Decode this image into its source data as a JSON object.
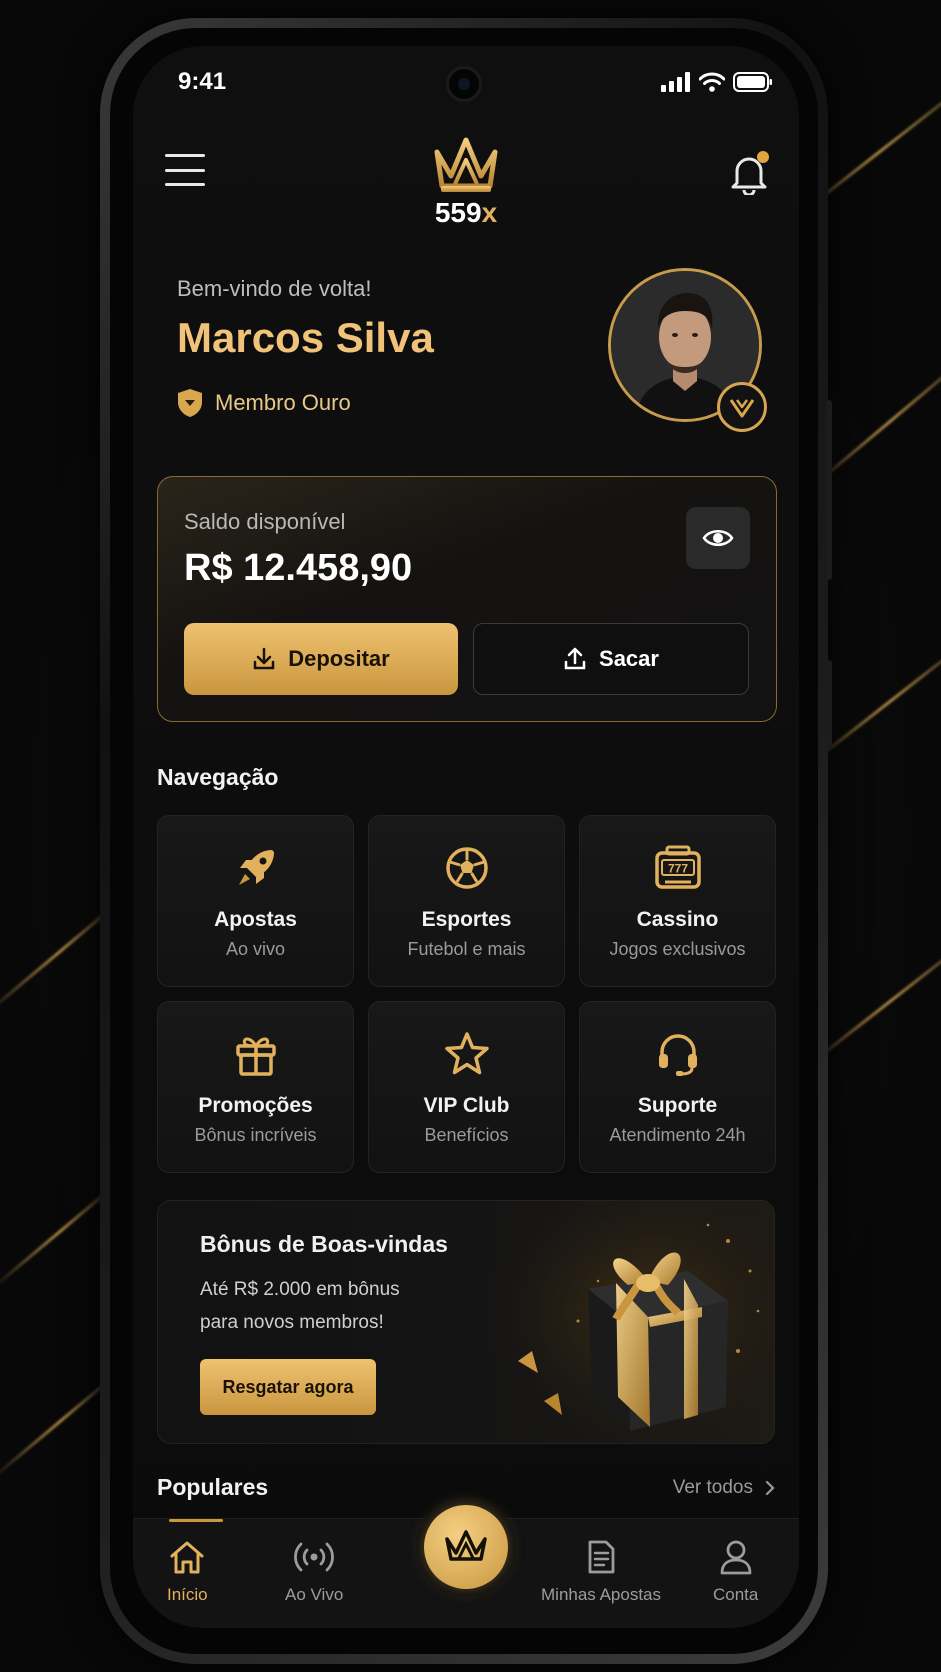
{
  "status_bar": {
    "time": "9:41"
  },
  "header": {
    "logo_text": "559",
    "logo_suffix": "x"
  },
  "profile": {
    "greeting": "Bem-vindo de volta!",
    "name": "Marcos Silva",
    "membership": "Membro Ouro"
  },
  "balance": {
    "label": "Saldo disponível",
    "value": "R$ 12.458,90",
    "deposit_label": "Depositar",
    "withdraw_label": "Sacar"
  },
  "navigation": {
    "title": "Navegação",
    "items": [
      {
        "title": "Apostas",
        "subtitle": "Ao vivo",
        "icon": "rocket-icon"
      },
      {
        "title": "Esportes",
        "subtitle": "Futebol e mais",
        "icon": "soccer-ball-icon"
      },
      {
        "title": "Cassino",
        "subtitle": "Jogos exclusivos",
        "icon": "slot-machine-icon"
      },
      {
        "title": "Promoções",
        "subtitle": "Bônus incríveis",
        "icon": "gift-icon"
      },
      {
        "title": "VIP Club",
        "subtitle": "Benefícios",
        "icon": "star-icon"
      },
      {
        "title": "Suporte",
        "subtitle": "Atendimento 24h",
        "icon": "headset-icon"
      }
    ]
  },
  "promo": {
    "title": "Bônus de Boas-vindas",
    "line1": "Até R$ 2.000 em bônus",
    "line2": "para novos membros!",
    "button": "Resgatar agora"
  },
  "popular": {
    "title": "Populares",
    "see_all": "Ver todos"
  },
  "bottom_nav": {
    "items": [
      {
        "label": "Início",
        "icon": "home-icon",
        "active": true
      },
      {
        "label": "Ao Vivo",
        "icon": "live-broadcast-icon"
      },
      {
        "label": "Minhas Apostas",
        "icon": "document-icon"
      },
      {
        "label": "Conta",
        "icon": "user-icon"
      }
    ]
  },
  "colors": {
    "accent": "#e2b15d",
    "background": "#0b0b0b"
  }
}
